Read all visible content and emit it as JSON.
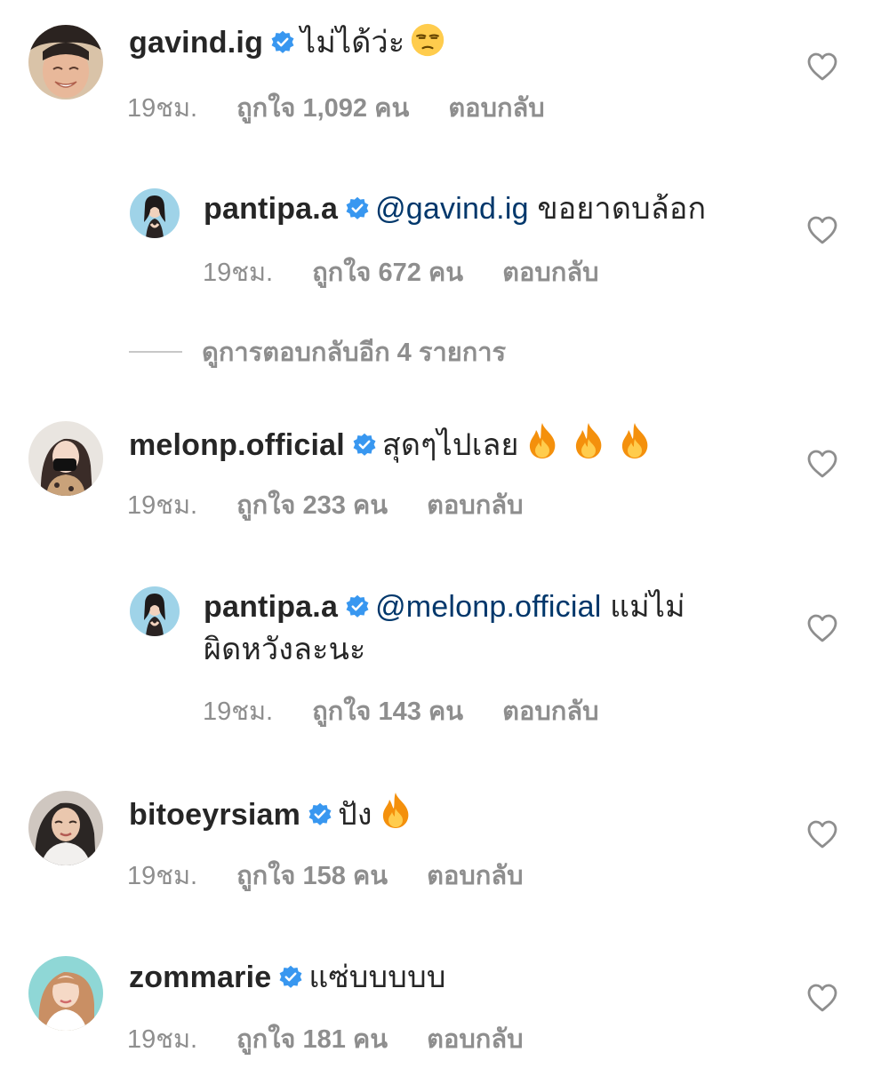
{
  "comments": [
    {
      "username": "gavind.ig",
      "mention": "",
      "text": "ไม่ได้ว่ะ",
      "emoji": "unamused-face-emoji",
      "time": "19ชม.",
      "likes": "ถูกใจ 1,092 คน",
      "reply": "ตอบกลับ"
    },
    {
      "username": "pantipa.a",
      "mention": "@gavind.ig",
      "text": "ขอยาดบล้อก",
      "time": "19ชม.",
      "likes": "ถูกใจ 672 คน",
      "reply": "ตอบกลับ"
    },
    {
      "username": "melonp.official",
      "mention": "",
      "text": "สุดๆไปเลย",
      "emoji": "fire-emoji",
      "time": "19ชม.",
      "likes": "ถูกใจ 233 คน",
      "reply": "ตอบกลับ"
    },
    {
      "username": "pantipa.a",
      "mention": "@melonp.official",
      "text": "แม่ไม่",
      "text_line2": "ผิดหวังละนะ",
      "time": "19ชม.",
      "likes": "ถูกใจ 143 คน",
      "reply": "ตอบกลับ"
    },
    {
      "username": "bitoeyrsiam",
      "mention": "",
      "text": "ปัง",
      "emoji": "fire-emoji",
      "time": "19ชม.",
      "likes": "ถูกใจ 158 คน",
      "reply": "ตอบกลับ"
    },
    {
      "username": "zommarie",
      "mention": "",
      "text": "แซ่บบบบบ",
      "time": "19ชม.",
      "likes": "ถูกใจ 181 คน",
      "reply": "ตอบกลับ"
    }
  ],
  "view_replies": "ดูการตอบกลับอีก 4 รายการ",
  "colors": {
    "text": "#262626",
    "secondary": "#8e8e8e",
    "mention": "#00376b",
    "verified": "#3897f0",
    "divider": "#c7c7c7"
  }
}
